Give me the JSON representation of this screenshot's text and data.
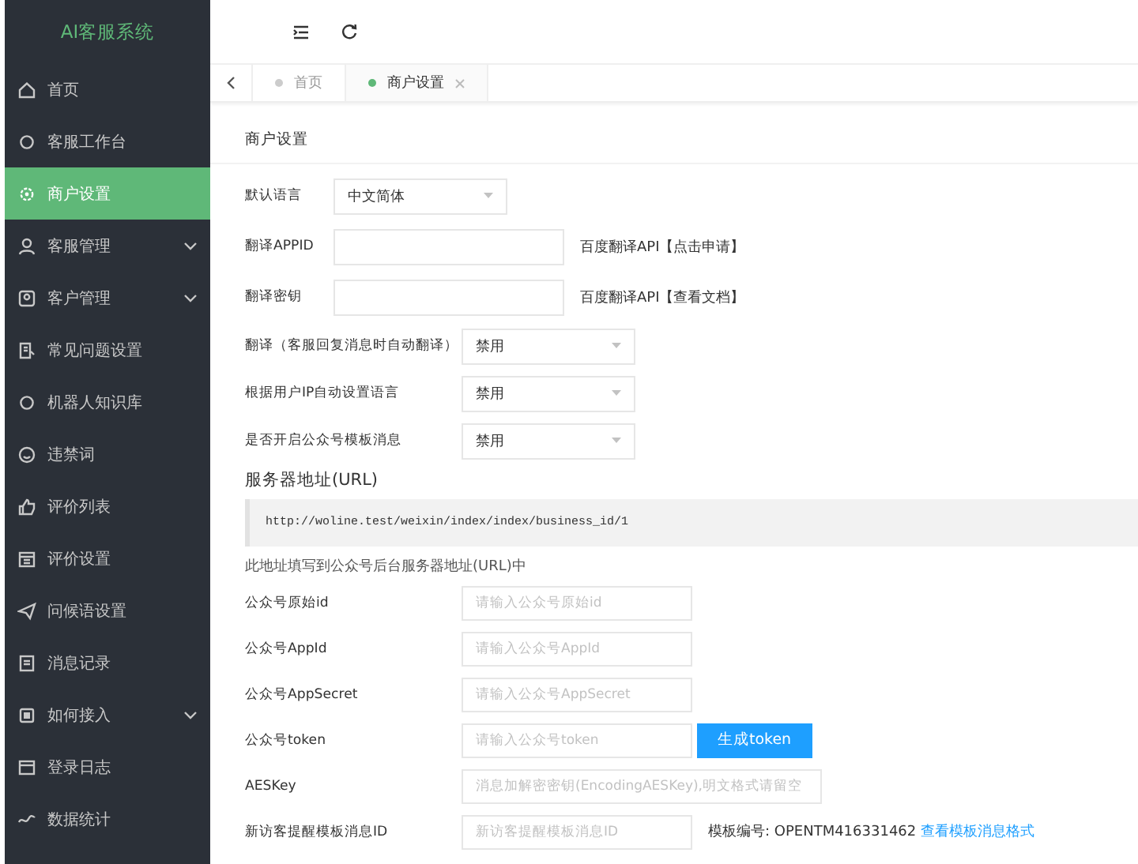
{
  "sidebar": {
    "title": "AI客服系统",
    "items": [
      {
        "label": "首页",
        "selected": false,
        "expandable": false
      },
      {
        "label": "客服工作台",
        "selected": false,
        "expandable": false
      },
      {
        "label": "商户设置",
        "selected": true,
        "expandable": false
      },
      {
        "label": "客服管理",
        "selected": false,
        "expandable": true
      },
      {
        "label": "客户管理",
        "selected": false,
        "expandable": true
      },
      {
        "label": "常见问题设置",
        "selected": false,
        "expandable": false
      },
      {
        "label": "机器人知识库",
        "selected": false,
        "expandable": false
      },
      {
        "label": "违禁词",
        "selected": false,
        "expandable": false
      },
      {
        "label": "评价列表",
        "selected": false,
        "expandable": false
      },
      {
        "label": "评价设置",
        "selected": false,
        "expandable": false
      },
      {
        "label": "问候语设置",
        "selected": false,
        "expandable": false
      },
      {
        "label": "消息记录",
        "selected": false,
        "expandable": false
      },
      {
        "label": "如何接入",
        "selected": false,
        "expandable": true
      },
      {
        "label": "登录日志",
        "selected": false,
        "expandable": false
      },
      {
        "label": "数据统计",
        "selected": false,
        "expandable": false
      }
    ]
  },
  "tabs": [
    {
      "label": "首页",
      "selected": false,
      "closable": false
    },
    {
      "label": "商户设置",
      "selected": true,
      "closable": true
    }
  ],
  "card": {
    "title": "商户设置",
    "language_rows": [
      {
        "label": "默认语言",
        "kind": "select",
        "value": "中文简体"
      },
      {
        "label": "翻译APPID",
        "kind": "input",
        "note": "百度翻译API【点击申请】"
      },
      {
        "label": "翻译密钥",
        "kind": "input",
        "note": "百度翻译API【查看文档】"
      }
    ],
    "option_rows": [
      {
        "label": "翻译（客服回复消息时自动翻译）",
        "kind": "select",
        "value": "禁用"
      },
      {
        "label": "根据用户IP自动设置语言",
        "kind": "select",
        "value": "禁用"
      },
      {
        "label": "是否开启公众号模板消息",
        "kind": "select",
        "value": "禁用"
      }
    ],
    "server_url": {
      "heading": "服务器地址(URL)",
      "url": "http://woline.test/weixin/index/index/business_id/1",
      "hint": "此地址填写到公众号后台服务器地址(URL)中"
    },
    "wechat_rows": [
      {
        "label": "公众号原始id",
        "kind": "input",
        "placeholder": "请输入公众号原始id"
      },
      {
        "label": "公众号AppId",
        "kind": "input",
        "placeholder": "请输入公众号AppId"
      },
      {
        "label": "公众号AppSecret",
        "kind": "input",
        "placeholder": "请输入公众号AppSecret"
      },
      {
        "label": "公众号token",
        "kind": "input_button",
        "placeholder": "请输入公众号token",
        "button": "生成token"
      },
      {
        "label": "AESKey",
        "kind": "wide_input",
        "placeholder": "消息加解密密钥(EncodingAESKey),明文格式请留空"
      },
      {
        "label": "新访客提醒模板消息ID",
        "kind": "input",
        "placeholder": "新访客提醒模板消息ID",
        "note": "模板编号: OPENTM416331462",
        "link": "查看模板消息格式"
      }
    ]
  }
}
